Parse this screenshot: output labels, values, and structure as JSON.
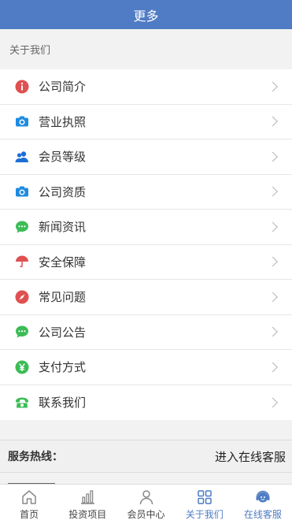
{
  "header": {
    "title": "更多"
  },
  "section": {
    "title": "关于我们"
  },
  "menu": [
    {
      "label": "公司简介",
      "icon": "info-icon",
      "color": "#e05050"
    },
    {
      "label": "营业执照",
      "icon": "camera-icon",
      "color": "#1e8be0"
    },
    {
      "label": "会员等级",
      "icon": "users-icon",
      "color": "#1e6ed6"
    },
    {
      "label": "公司资质",
      "icon": "camera-icon",
      "color": "#1e8be0"
    },
    {
      "label": "新闻资讯",
      "icon": "chat-icon",
      "color": "#3cbc56"
    },
    {
      "label": "安全保障",
      "icon": "umbrella-icon",
      "color": "#e05050"
    },
    {
      "label": "常见问题",
      "icon": "compass-icon",
      "color": "#e05050"
    },
    {
      "label": "公司公告",
      "icon": "chat-icon",
      "color": "#3cbc56"
    },
    {
      "label": "支付方式",
      "icon": "yen-icon",
      "color": "#3cbc56"
    },
    {
      "label": "联系我们",
      "icon": "phone-icon",
      "color": "#3cbc56"
    }
  ],
  "hotline": {
    "label": "服务热线：",
    "link": "进入在线客服"
  },
  "tabs": [
    {
      "label": "首页",
      "icon": "home-icon",
      "active": false
    },
    {
      "label": "投资项目",
      "icon": "bar-chart-icon",
      "active": false
    },
    {
      "label": "会员中心",
      "icon": "user-icon",
      "active": false
    },
    {
      "label": "关于我们",
      "icon": "grid-icon",
      "active": true
    },
    {
      "label": "在线客服",
      "icon": "headset-icon",
      "active": true
    }
  ],
  "colors": {
    "primary": "#4f7cc4"
  }
}
